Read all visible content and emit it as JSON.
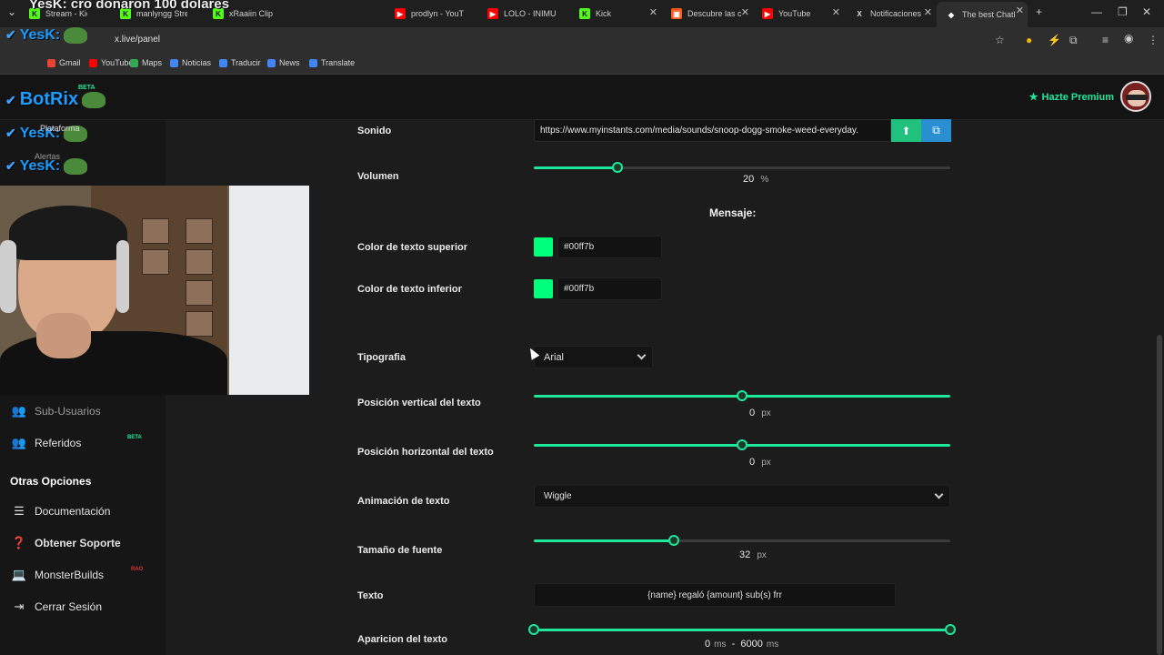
{
  "browser": {
    "tabs": [
      {
        "label": "Stream - Kick",
        "fav": "K",
        "color": "#53fc18"
      },
      {
        "label": "manlyngg Stre",
        "fav": "K",
        "color": "#53fc18"
      },
      {
        "label": "xRaaiin Clips",
        "fav": "K",
        "color": "#53fc18"
      },
      {
        "label": "prodlyn - YouT",
        "fav": "▶",
        "color": "#ff0000"
      },
      {
        "label": "LOLO - INIMU",
        "fav": "▶",
        "color": "#ff0000"
      },
      {
        "label": "Kick",
        "fav": "K",
        "color": "#53fc18"
      },
      {
        "label": "Descubre las c",
        "fav": "▣",
        "color": "#ff5a1f"
      },
      {
        "label": "YouTube",
        "fav": "▶",
        "color": "#ff0000"
      },
      {
        "label": "Notificaciones",
        "fav": "X",
        "color": "#dddddd"
      },
      {
        "label": "The best Chatl",
        "fav": "◆",
        "color": "#ffffff"
      }
    ],
    "url": "x.live/panel",
    "bookmarks": [
      {
        "label": "Gmail",
        "color": "#ea4335"
      },
      {
        "label": "YouTube",
        "color": "#ff0000"
      },
      {
        "label": "Maps",
        "color": "#34a853"
      },
      {
        "label": "Noticias",
        "color": "#4285f4"
      },
      {
        "label": "Traducir",
        "color": "#4285f4"
      },
      {
        "label": "News",
        "color": "#4285f4"
      },
      {
        "label": "Translate",
        "color": "#4285f4"
      }
    ]
  },
  "overlay": {
    "chat_top": "YesK: cro donaron 100 dolares",
    "chat_lines": [
      "YesK:",
      "BotRix",
      "YesK:",
      "YesK:"
    ],
    "beta": "BETA",
    "sidebar_fragments": [
      "Plataforma",
      "Alertas"
    ]
  },
  "header": {
    "premium_label": "Hazte Premium"
  },
  "sidebar": {
    "items": [
      {
        "label": "Sub-Usuarios",
        "icon": "users-icon"
      },
      {
        "label": "Referidos",
        "icon": "user-group-icon",
        "badge": "BETA"
      }
    ],
    "section_title": "Otras Opciones",
    "other": [
      {
        "label": "Documentación",
        "icon": "list-icon"
      },
      {
        "label": "Obtener Soporte",
        "icon": "help-icon"
      },
      {
        "label": "MonsterBuilds",
        "icon": "laptop-icon",
        "badge": "RAO"
      },
      {
        "label": "Cerrar Sesión",
        "icon": "logout-icon"
      }
    ]
  },
  "form": {
    "sound_label": "Sonido",
    "sound_url": "https://www.myinstants.com/media/sounds/snoop-dogg-smoke-weed-everyday.",
    "volume_label": "Volumen",
    "volume_value": "20",
    "volume_unit": "%",
    "volume_level": 0.2,
    "mensaje_heading": "Mensaje:",
    "top_color_label": "Color de texto superior",
    "top_color": "#00ff7b",
    "bottom_color_label": "Color de texto inferior",
    "bottom_color": "#00ff7b",
    "font_label": "Tipografia",
    "font_value": "Arial",
    "vpos_label": "Posición vertical del texto",
    "vpos_value": "0",
    "hpos_label": "Posición horizontal del texto",
    "hpos_value": "0",
    "px_unit": "px",
    "anim_label": "Animación de texto",
    "anim_value": "Wiggle",
    "size_label": "Tamaño de fuente",
    "size_value": "32",
    "text_label": "Texto",
    "text_value": "{name} regaló {amount} sub(s) frr",
    "appear_label": "Aparicion del texto",
    "appear_start": "0",
    "appear_end": "6000",
    "ms_unit": "ms",
    "dash": "-"
  },
  "colors": {
    "accent": "#1de79b",
    "swatch": "#00ff7b"
  }
}
